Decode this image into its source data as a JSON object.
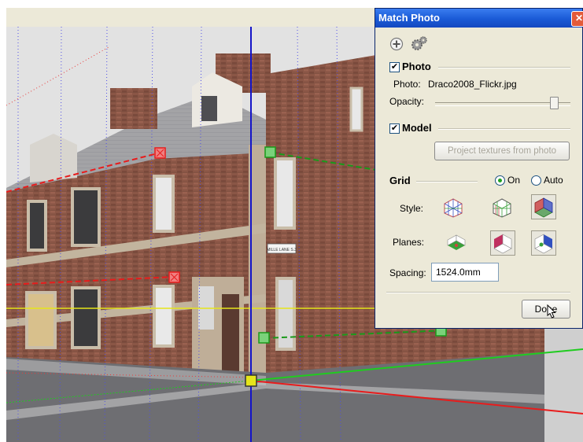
{
  "dialog": {
    "title": "Match Photo",
    "photo_section": {
      "label": "Photo",
      "checked": true,
      "photo_caption": "Photo:",
      "photo_name": "Draco2008_Flickr.jpg",
      "opacity_label": "Opacity:",
      "opacity_value": 0.9
    },
    "model_section": {
      "label": "Model",
      "checked": true,
      "project_button": "Project textures from photo"
    },
    "grid_section": {
      "label": "Grid",
      "on_label": "On",
      "auto_label": "Auto",
      "selected": "On",
      "style_label": "Style:",
      "planes_label": "Planes:",
      "spacing_label": "Spacing:",
      "spacing_value": "1524.0mm"
    },
    "done_button": "Done"
  },
  "photo": {
    "sign_text": "MILLE LANE S.3"
  },
  "colors": {
    "red_axis": "#e81c1c",
    "green_axis": "#1fcc1f",
    "blue_axis": "#1414c8",
    "horizon": "#e5e51a",
    "title_bar": "#1a5ad6"
  },
  "icons": [
    "add-photo-icon",
    "settings-gear-icon",
    "grid-style-icon",
    "grid-plane-icon",
    "mouse-cursor-icon"
  ]
}
